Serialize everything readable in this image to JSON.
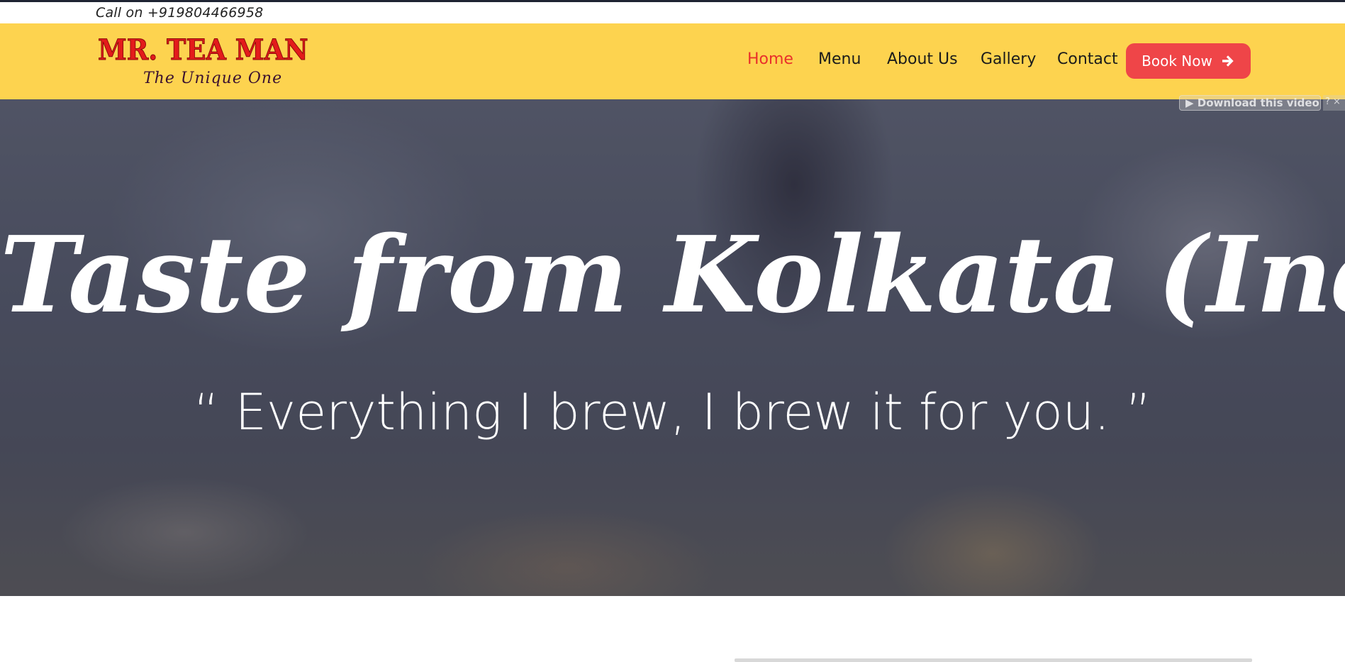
{
  "topbar": {
    "call_text": "Call on +919804466958"
  },
  "brand": {
    "name": "MR. TEA MAN",
    "tagline": "The Unique One"
  },
  "nav": {
    "items": [
      {
        "label": "Home",
        "active": true
      },
      {
        "label": "Menu",
        "active": false
      },
      {
        "label": "About Us",
        "active": false
      },
      {
        "label": "Gallery",
        "active": false
      },
      {
        "label": "Contact",
        "active": false
      }
    ],
    "book_label": "Book Now"
  },
  "hero": {
    "title": "Taste from Kolkata (India)",
    "quote": "“ Everything I brew, I brew it for you. ”",
    "download_label": "▶ Download this video",
    "video_controls": "? ×"
  },
  "colors": {
    "nav_bg": "#fdd34f",
    "accent_red": "#e9302b",
    "button_bg": "#ef4548",
    "logo_red": "#e31b1b"
  }
}
